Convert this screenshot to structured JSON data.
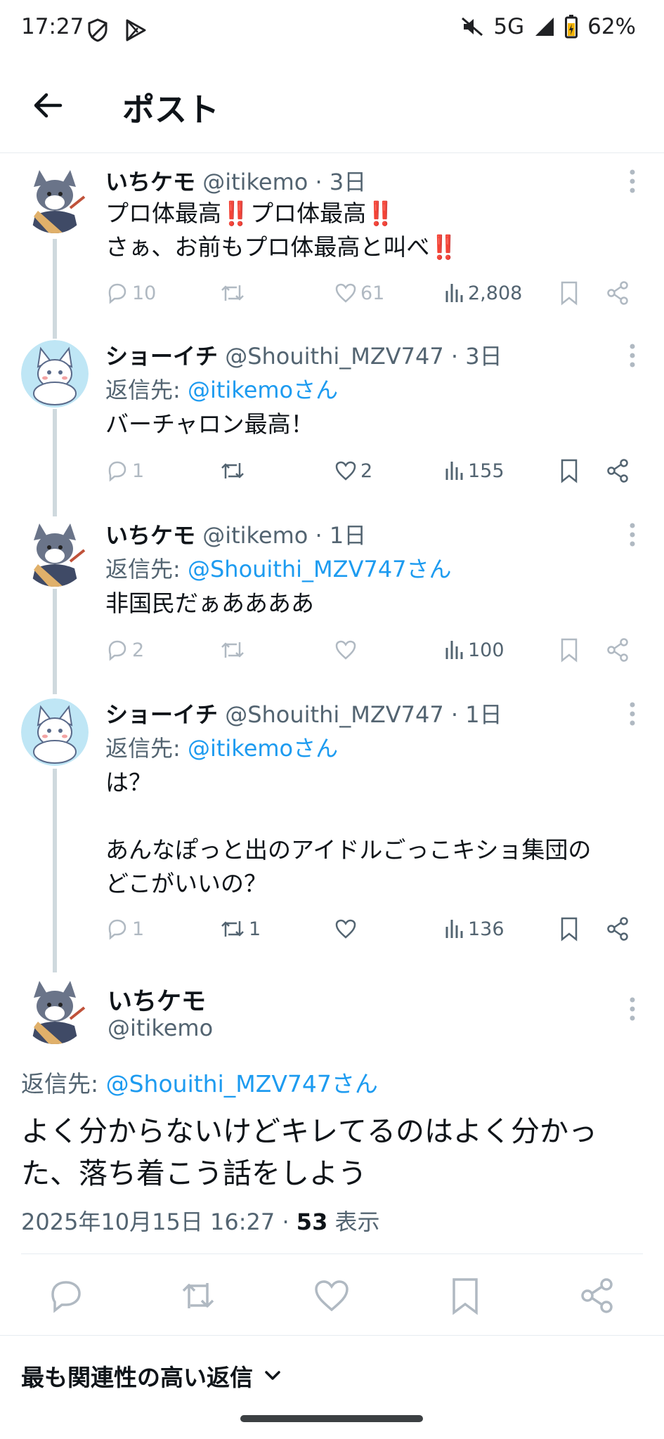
{
  "status_bar": {
    "time": "17:27",
    "network": "5G",
    "battery": "62%"
  },
  "header": {
    "title": "ポスト"
  },
  "thread": [
    {
      "name": "いちケモ",
      "handle": "@itikemo",
      "time": "· 3日",
      "reply_to_prefix": "",
      "reply_to": "",
      "text": "プロ体最高‼️プロ体最高‼️\nさぁ、お前もプロ体最高と叫べ‼️",
      "replies": "10",
      "reposts": "",
      "likes": "61",
      "views": "2,808",
      "avatar": "wolf"
    },
    {
      "name": "ショーイチ",
      "handle": "@Shouithi_MZV747",
      "time": "· 3日",
      "reply_to_prefix": "返信先: ",
      "reply_to": "@itikemoさん",
      "text": "バーチャロン最高！",
      "replies": "1",
      "reposts": "",
      "likes": "2",
      "views": "155",
      "avatar": "fox"
    },
    {
      "name": "いちケモ",
      "handle": "@itikemo",
      "time": "· 1日",
      "reply_to_prefix": "返信先: ",
      "reply_to": "@Shouithi_MZV747さん",
      "text": "非国民だぁああああ",
      "replies": "2",
      "reposts": "",
      "likes": "",
      "views": "100",
      "avatar": "wolf"
    },
    {
      "name": "ショーイチ",
      "handle": "@Shouithi_MZV747",
      "time": "· 1日",
      "reply_to_prefix": "返信先: ",
      "reply_to": "@itikemoさん",
      "text": "は？\n\nあんなぽっと出のアイドルごっこキショ集団の\nどこがいいの？",
      "replies": "1",
      "reposts": "1",
      "likes": "",
      "views": "136",
      "avatar": "fox"
    }
  ],
  "main_post": {
    "name": "いちケモ",
    "handle": "@itikemo",
    "reply_to_prefix": "返信先: ",
    "reply_to": "@Shouithi_MZV747さん",
    "text": "よく分からないけどキレてるのはよく分かった、落ち着こう話をしよう",
    "timestamp": "2025年10月15日 16:27 · ",
    "views_count": "53",
    "views_label": " 表示"
  },
  "sort_label": "最も関連性の高い返信",
  "colors": {
    "link": "#1d9bf0",
    "muted": "#536471",
    "faded_icon": "#b0b9c2"
  }
}
